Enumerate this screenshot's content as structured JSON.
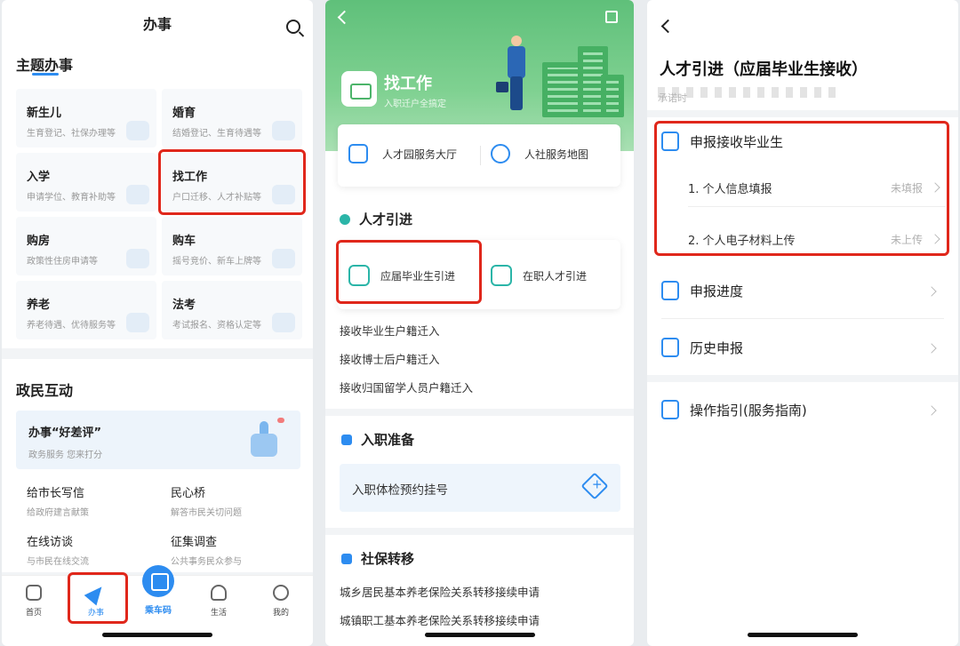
{
  "screen1": {
    "header_title": "办事",
    "section1_title": "主题办事",
    "cards": [
      {
        "title": "新生儿",
        "sub": "生育登记、社保办理等"
      },
      {
        "title": "婚育",
        "sub": "结婚登记、生育待遇等"
      },
      {
        "title": "入学",
        "sub": "申请学位、教育补助等"
      },
      {
        "title": "找工作",
        "sub": "户口迁移、人才补贴等"
      },
      {
        "title": "购房",
        "sub": "政策性住房申请等"
      },
      {
        "title": "购车",
        "sub": "摇号竞价、新车上牌等"
      },
      {
        "title": "养老",
        "sub": "养老待遇、优待服务等"
      },
      {
        "title": "法考",
        "sub": "考试报名、资格认定等"
      }
    ],
    "section2_title": "政民互动",
    "banner": {
      "title": "办事“好差评”",
      "sub": "政务服务 您来打分"
    },
    "links": [
      {
        "title": "给市长写信",
        "sub": "给政府建言献策"
      },
      {
        "title": "民心桥",
        "sub": "解答市民关切问题"
      },
      {
        "title": "在线访谈",
        "sub": "与市民在线交流"
      },
      {
        "title": "征集调查",
        "sub": "公共事务民众参与"
      }
    ],
    "tabs": {
      "home": "首页",
      "service": "办事",
      "bus": "乘车码",
      "life": "生活",
      "me": "我的"
    },
    "highlight_color": "#e0271b"
  },
  "screen2": {
    "hero_title": "找工作",
    "hero_sub": "入职迁户全搞定",
    "svc1": "人才园服务大厅",
    "svc2": "人社服务地图",
    "section_talent": "人才引进",
    "talent1": "应届毕业生引进",
    "talent2": "在职人才引进",
    "links": [
      "接收毕业生户籍迁入",
      "接收博士后户籍迁入",
      "接收归国留学人员户籍迁入"
    ],
    "section_onboard": "入职准备",
    "exam": "入职体检预约挂号",
    "section_social": "社保转移",
    "social_links": [
      "城乡居民基本养老保险关系转移接续申请",
      "城镇职工基本养老保险关系转移接续申请"
    ]
  },
  "screen3": {
    "title": "人才引进（应届毕业生接收）",
    "sub": "承诺时",
    "menu_apply": "申报接收毕业生",
    "step1": "1. 个人信息填报",
    "step1_status": "未填报",
    "step2": "2. 个人电子材料上传",
    "step2_status": "未上传",
    "menu_progress": "申报进度",
    "menu_history": "历史申报",
    "menu_guide": "操作指引(服务指南)"
  }
}
